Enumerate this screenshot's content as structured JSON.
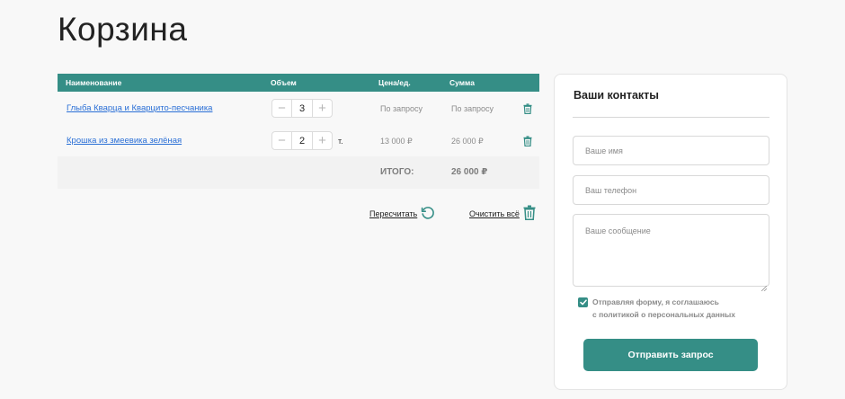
{
  "page": {
    "title": "Корзина"
  },
  "cart": {
    "columns": {
      "name": "Наименование",
      "volume": "Объем",
      "price": "Цена/ед.",
      "sum": "Сумма"
    },
    "items": [
      {
        "name": "Глыба Кварца и Кварцито-песчаника",
        "qty": "3",
        "unit": "",
        "price": "По запросу",
        "sum": "По запросу"
      },
      {
        "name": "Крошка из змеевика зелёная",
        "qty": "2",
        "unit": "т.",
        "price": "13 000 ₽",
        "sum": "26 000 ₽"
      }
    ],
    "total_label": "ИТОГО:",
    "total_value": "26 000 ₽",
    "recalc_label": "Пересчитать",
    "clear_label": "Очистить всё"
  },
  "contacts": {
    "title": "Ваши контакты",
    "name_placeholder": "Ваше имя",
    "phone_placeholder": "Ваш телефон",
    "message_placeholder": "Ваше сообщение",
    "consent_line1": "Отправляя форму, я соглашаюсь",
    "consent_line2": "с политикой о персональных данных",
    "consent_checked": true,
    "submit_label": "Отправить запрос"
  },
  "colors": {
    "accent": "#358e86",
    "link": "#2a6fd6"
  }
}
